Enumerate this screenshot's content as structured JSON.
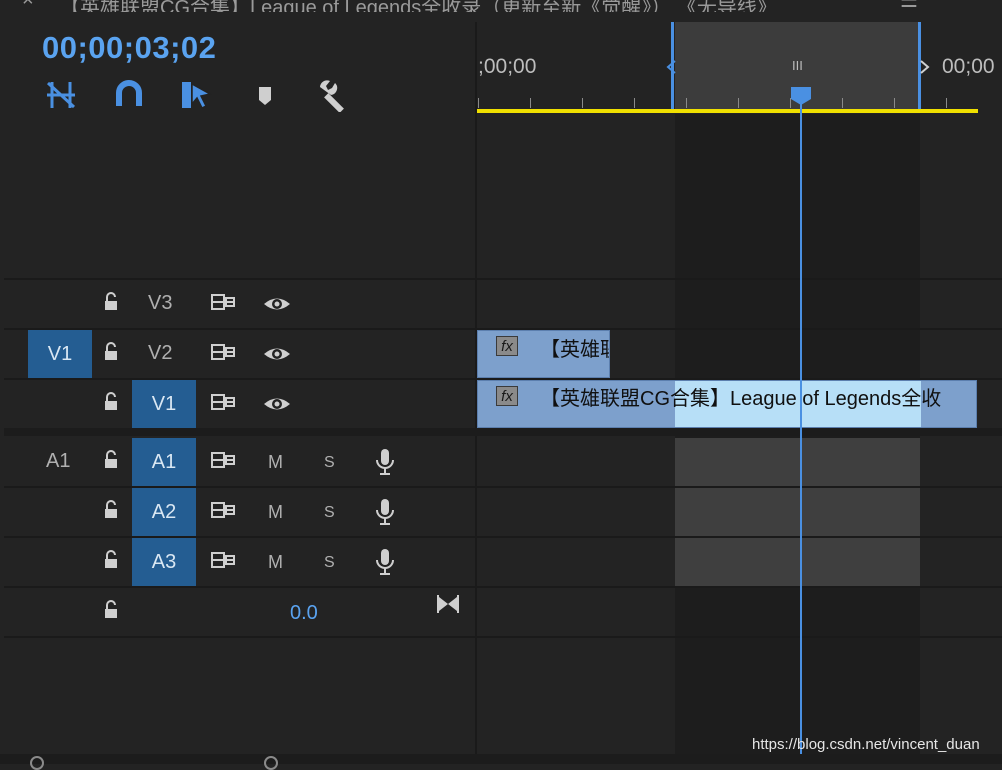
{
  "window": {
    "tab_title": "【英雄联盟CG合集】League of Legends全收录（更新至新《觉醒》）    《无导线》",
    "close_glyph": "×",
    "menu_glyph": "☰"
  },
  "timeline": {
    "timecode": "00;00;03;02",
    "ruler": {
      "label_start": ";00;00",
      "label_end": "00;00",
      "marker_glyph": "III"
    },
    "toolbar": [
      {
        "name": "insert-sequence-nested-icon"
      },
      {
        "name": "snap-icon"
      },
      {
        "name": "linked-selection-icon"
      },
      {
        "name": "add-marker-icon"
      },
      {
        "name": "settings-wrench-icon"
      }
    ],
    "tracks": {
      "video": [
        {
          "target": "",
          "id": "V3",
          "id_highlight": false
        },
        {
          "target": "V1",
          "id": "V2",
          "id_highlight": false
        },
        {
          "target": "",
          "id": "V1",
          "id_highlight": true
        }
      ],
      "audio": [
        {
          "target": "A1",
          "id": "A1",
          "mute": "M",
          "solo": "S"
        },
        {
          "target": "",
          "id": "A2",
          "mute": "M",
          "solo": "S"
        },
        {
          "target": "",
          "id": "A3",
          "mute": "M",
          "solo": "S"
        }
      ],
      "master_volume": "0.0"
    },
    "clips": [
      {
        "track": "V2",
        "fx": "fx",
        "name": "【英雄联"
      },
      {
        "track": "V1",
        "fx": "fx",
        "name": "【英雄联盟CG合集】League of Legends全收"
      }
    ],
    "colors": {
      "timecode": "#5aa3f0",
      "track_target": "#245d92",
      "clip": "#7da0cc",
      "clip_selected": "#b7dff7",
      "work_area": "#f0e000",
      "playhead": "#4a90e2"
    }
  },
  "watermark": "https://blog.csdn.net/vincent_duan"
}
